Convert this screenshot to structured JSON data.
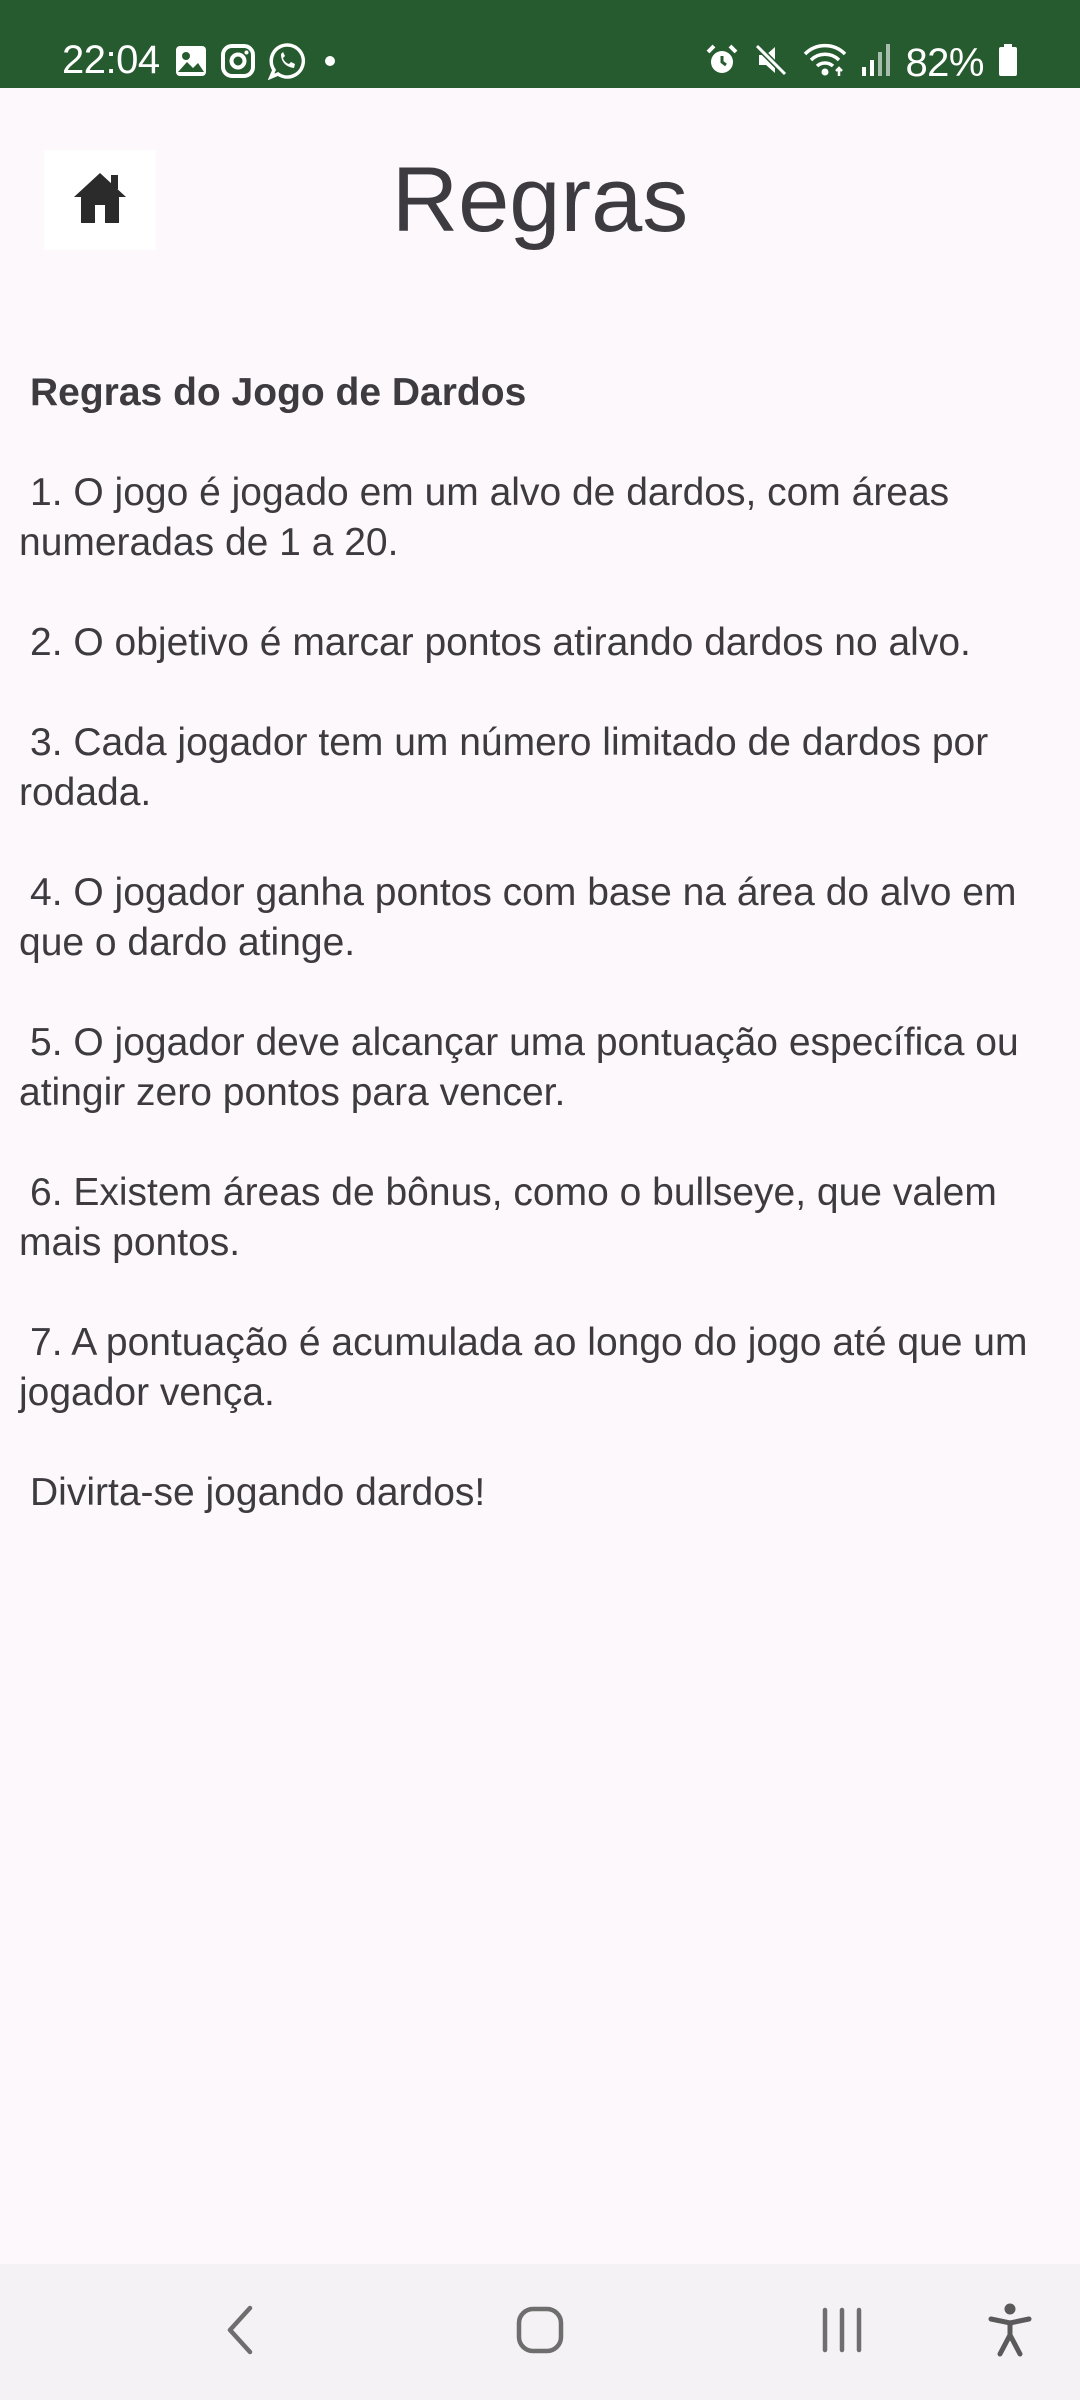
{
  "status_bar": {
    "time": "22:04",
    "battery_percent": "82%",
    "notification_icons": [
      "gallery-icon",
      "instagram-icon",
      "whatsapp-icon",
      "dot-icon"
    ],
    "system_icons": [
      "alarm-icon",
      "mute-icon",
      "wifi-icon",
      "signal-icon",
      "battery-icon"
    ],
    "background_color": "#265a2f"
  },
  "header": {
    "title": "Regras",
    "home_icon": "home-icon"
  },
  "rules": {
    "heading": "Regras do Jogo de Dardos",
    "items": [
      "1. O jogo é jogado em um alvo de dardos, com áreas numeradas de 1 a 20.",
      "2. O objetivo é marcar pontos atirando dardos no alvo.",
      "3. Cada jogador tem um número limitado de dardos por rodada.",
      "4. O jogador ganha pontos com base na área do alvo em que o dardo atinge.",
      "5. O jogador deve alcançar uma pontuação específica ou atingir zero pontos para vencer.",
      "6. Existem áreas de bônus, como o bullseye, que valem mais pontos.",
      "7. A pontuação é acumulada ao longo do jogo até que um jogador vença."
    ],
    "closing": "Divirta-se jogando dardos!"
  },
  "nav_bar": {
    "buttons": [
      "back-icon",
      "home-circle-icon",
      "recents-icon",
      "accessibility-icon"
    ]
  }
}
